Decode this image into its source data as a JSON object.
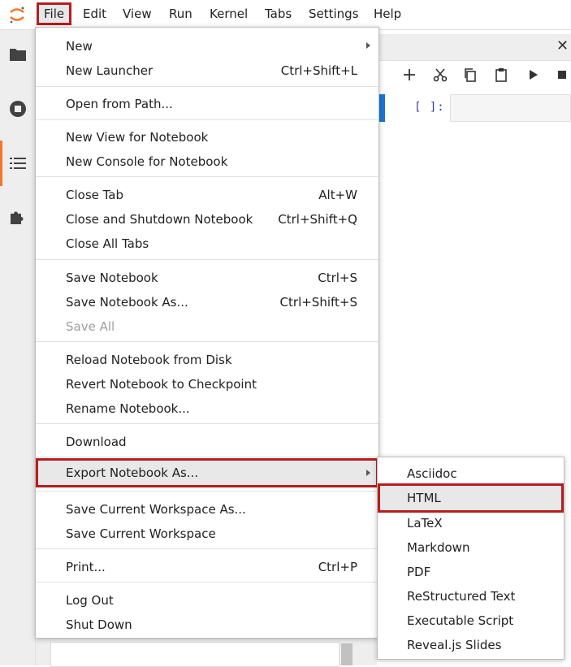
{
  "menubar": {
    "items": [
      "File",
      "Edit",
      "View",
      "Run",
      "Kernel",
      "Tabs",
      "Settings",
      "Help"
    ]
  },
  "sidebar": {
    "icons": [
      "folder-icon",
      "running-icon",
      "toc-icon",
      "extension-icon"
    ]
  },
  "notebook": {
    "prompt": "[ ]:"
  },
  "file_menu": {
    "new": "New",
    "new_launcher": "New Launcher",
    "new_launcher_sc": "Ctrl+Shift+L",
    "open_from_path": "Open from Path...",
    "new_view": "New View for Notebook",
    "new_console": "New Console for Notebook",
    "close_tab": "Close Tab",
    "close_tab_sc": "Alt+W",
    "close_shutdown": "Close and Shutdown Notebook",
    "close_shutdown_sc": "Ctrl+Shift+Q",
    "close_all": "Close All Tabs",
    "save": "Save Notebook",
    "save_sc": "Ctrl+S",
    "save_as": "Save Notebook As...",
    "save_as_sc": "Ctrl+Shift+S",
    "save_all": "Save All",
    "reload": "Reload Notebook from Disk",
    "revert": "Revert Notebook to Checkpoint",
    "rename": "Rename Notebook...",
    "download": "Download",
    "export": "Export Notebook As...",
    "save_workspace_as": "Save Current Workspace As...",
    "save_workspace": "Save Current Workspace",
    "print": "Print...",
    "print_sc": "Ctrl+P",
    "logout": "Log Out",
    "shutdown": "Shut Down"
  },
  "export_submenu": {
    "items": [
      "Asciidoc",
      "HTML",
      "LaTeX",
      "Markdown",
      "PDF",
      "ReStructured Text",
      "Executable Script",
      "Reveal.js Slides"
    ]
  },
  "colors": {
    "highlight_outline": "#b71c1c",
    "accent_orange": "#f37726",
    "cell_accent": "#1976d2"
  }
}
